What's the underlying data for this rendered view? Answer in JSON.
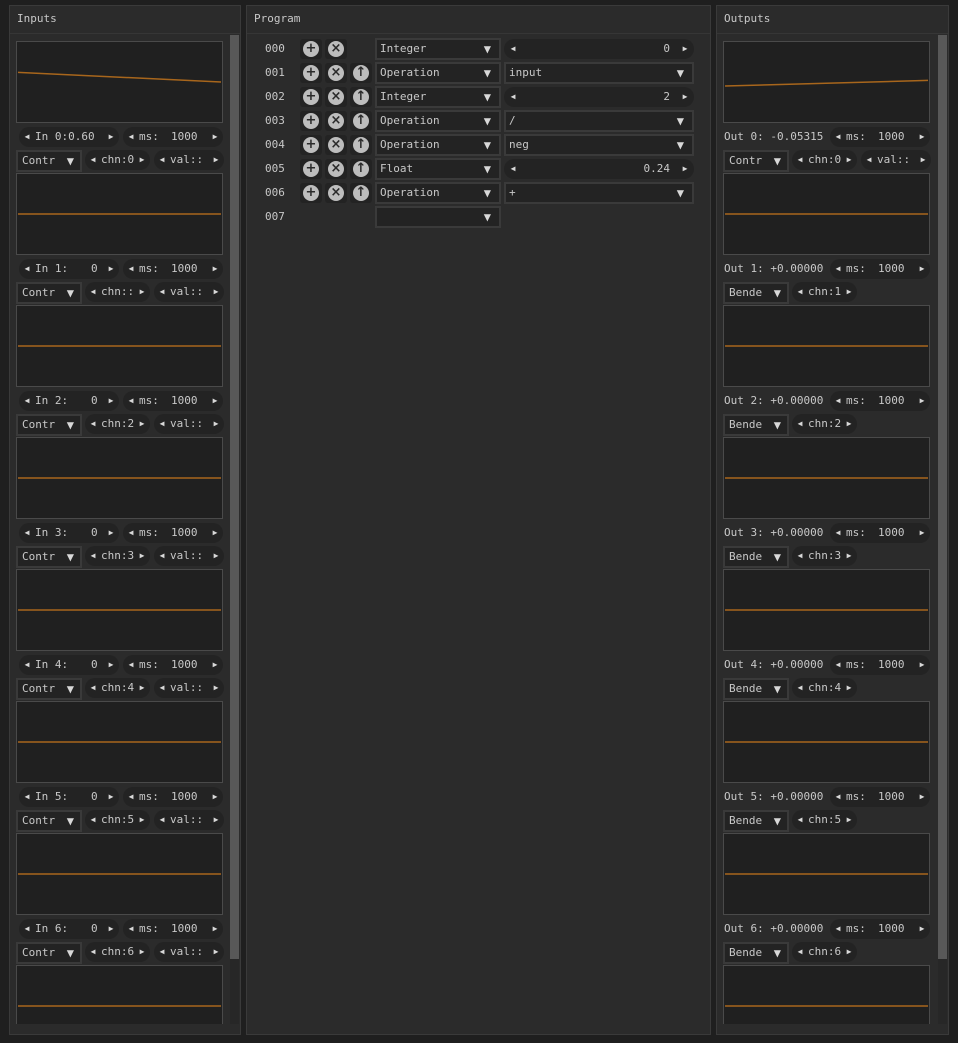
{
  "colors": {
    "trace": "#a8661c",
    "graph_bg": "#202020",
    "panel_bg": "#2b2b2b"
  },
  "inputs": {
    "title": "Inputs",
    "channels": [
      {
        "label": "In 0:0.60",
        "ms_label": "ms:",
        "ms": "1000",
        "mode": "Contr",
        "chn": "chn:0",
        "val": "val::",
        "trace": [
          0.62,
          0.5
        ]
      },
      {
        "label": "In 1:",
        "value": "0",
        "ms_label": "ms:",
        "ms": "1000",
        "mode": "Contr",
        "chn": "chn::",
        "val": "val::",
        "trace": [
          0.5,
          0.5
        ]
      },
      {
        "label": "In 2:",
        "value": "0",
        "ms_label": "ms:",
        "ms": "1000",
        "mode": "Contr",
        "chn": "chn:2",
        "val": "val::",
        "trace": [
          0.5,
          0.5
        ]
      },
      {
        "label": "In 3:",
        "value": "0",
        "ms_label": "ms:",
        "ms": "1000",
        "mode": "Contr",
        "chn": "chn:3",
        "val": "val::",
        "trace": [
          0.5,
          0.5
        ]
      },
      {
        "label": "In 4:",
        "value": "0",
        "ms_label": "ms:",
        "ms": "1000",
        "mode": "Contr",
        "chn": "chn:4",
        "val": "val::",
        "trace": [
          0.5,
          0.5
        ]
      },
      {
        "label": "In 5:",
        "value": "0",
        "ms_label": "ms:",
        "ms": "1000",
        "mode": "Contr",
        "chn": "chn:5",
        "val": "val::",
        "trace": [
          0.5,
          0.5
        ]
      },
      {
        "label": "In 6:",
        "value": "0",
        "ms_label": "ms:",
        "ms": "1000",
        "mode": "Contr",
        "chn": "chn:6",
        "val": "val::",
        "trace": [
          0.5,
          0.5
        ]
      },
      {
        "trace": [
          0.5,
          0.5
        ]
      }
    ]
  },
  "program": {
    "title": "Program",
    "rows": [
      {
        "num": "000",
        "has_up": false,
        "type": "Integer",
        "kind": "step",
        "value": "0"
      },
      {
        "num": "001",
        "has_up": true,
        "type": "Operation",
        "kind": "combo",
        "value": "input"
      },
      {
        "num": "002",
        "has_up": true,
        "type": "Integer",
        "kind": "step",
        "value": "2"
      },
      {
        "num": "003",
        "has_up": true,
        "type": "Operation",
        "kind": "combo",
        "value": "/"
      },
      {
        "num": "004",
        "has_up": true,
        "type": "Operation",
        "kind": "combo",
        "value": "neg"
      },
      {
        "num": "005",
        "has_up": true,
        "type": "Float",
        "kind": "step",
        "value": "0.24"
      },
      {
        "num": "006",
        "has_up": true,
        "type": "Operation",
        "kind": "combo",
        "value": "+"
      },
      {
        "num": "007",
        "has_up": false,
        "type": "",
        "kind": "empty",
        "value": ""
      }
    ]
  },
  "outputs": {
    "title": "Outputs",
    "channels": [
      {
        "label": "Out 0: -0.05315",
        "ms_label": "ms:",
        "ms": "1000",
        "mode": "Contr",
        "chn": "chn:0",
        "val": "val::",
        "trace": [
          0.45,
          0.52
        ]
      },
      {
        "label": "Out 1: +0.00000",
        "ms_label": "ms:",
        "ms": "1000",
        "mode": "Bende",
        "chn": "chn:1",
        "trace": [
          0.5,
          0.5
        ]
      },
      {
        "label": "Out 2: +0.00000",
        "ms_label": "ms:",
        "ms": "1000",
        "mode": "Bende",
        "chn": "chn:2",
        "trace": [
          0.5,
          0.5
        ]
      },
      {
        "label": "Out 3: +0.00000",
        "ms_label": "ms:",
        "ms": "1000",
        "mode": "Bende",
        "chn": "chn:3",
        "trace": [
          0.5,
          0.5
        ]
      },
      {
        "label": "Out 4: +0.00000",
        "ms_label": "ms:",
        "ms": "1000",
        "mode": "Bende",
        "chn": "chn:4",
        "trace": [
          0.5,
          0.5
        ]
      },
      {
        "label": "Out 5: +0.00000",
        "ms_label": "ms:",
        "ms": "1000",
        "mode": "Bende",
        "chn": "chn:5",
        "trace": [
          0.5,
          0.5
        ]
      },
      {
        "label": "Out 6: +0.00000",
        "ms_label": "ms:",
        "ms": "1000",
        "mode": "Bende",
        "chn": "chn:6",
        "trace": [
          0.5,
          0.5
        ]
      },
      {
        "trace": [
          0.5,
          0.5
        ]
      }
    ]
  }
}
